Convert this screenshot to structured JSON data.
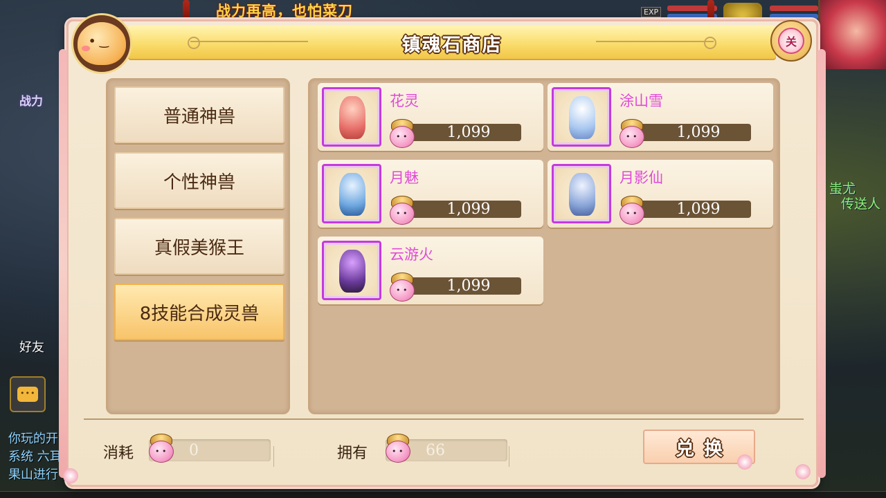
{
  "background": {
    "banner_text": "战力再高，也怕菜刀",
    "exp_label": "EXP",
    "left_overlay_text": "战力",
    "npc_labels": [
      "蚩尤",
      "传送人"
    ],
    "friend_label": "好友",
    "chat_lines": [
      "你玩的开",
      "系统 六耳",
      "果山进行"
    ]
  },
  "dialog": {
    "title": "镇魂石商店",
    "close_label": "关"
  },
  "categories": [
    {
      "label": "普通神兽",
      "active": false
    },
    {
      "label": "个性神兽",
      "active": false
    },
    {
      "label": "真假美猴王",
      "active": false
    },
    {
      "label": "8技能合成灵兽",
      "active": true
    }
  ],
  "items": [
    {
      "name": "花灵",
      "price": "1,099",
      "sprite_color": "#e8706a"
    },
    {
      "name": "涂山雪",
      "price": "1,099",
      "sprite_color": "#a9c8f0"
    },
    {
      "name": "月魅",
      "price": "1,099",
      "sprite_color": "#6fa8e0"
    },
    {
      "name": "月影仙",
      "price": "1,099",
      "sprite_color": "#8aa6d8"
    },
    {
      "name": "云游火",
      "price": "1,099",
      "sprite_color": "#6a3a9a"
    }
  ],
  "footer": {
    "cost_label": "消耗",
    "cost_value": "0",
    "owned_label": "拥有",
    "owned_value": "66",
    "exchange_label": "兑换"
  },
  "colors": {
    "item_name": "#e04ad8",
    "thumb_border": "#c43adc",
    "active_category": "#f8c46a",
    "title_bar": "#f9dc6a"
  }
}
